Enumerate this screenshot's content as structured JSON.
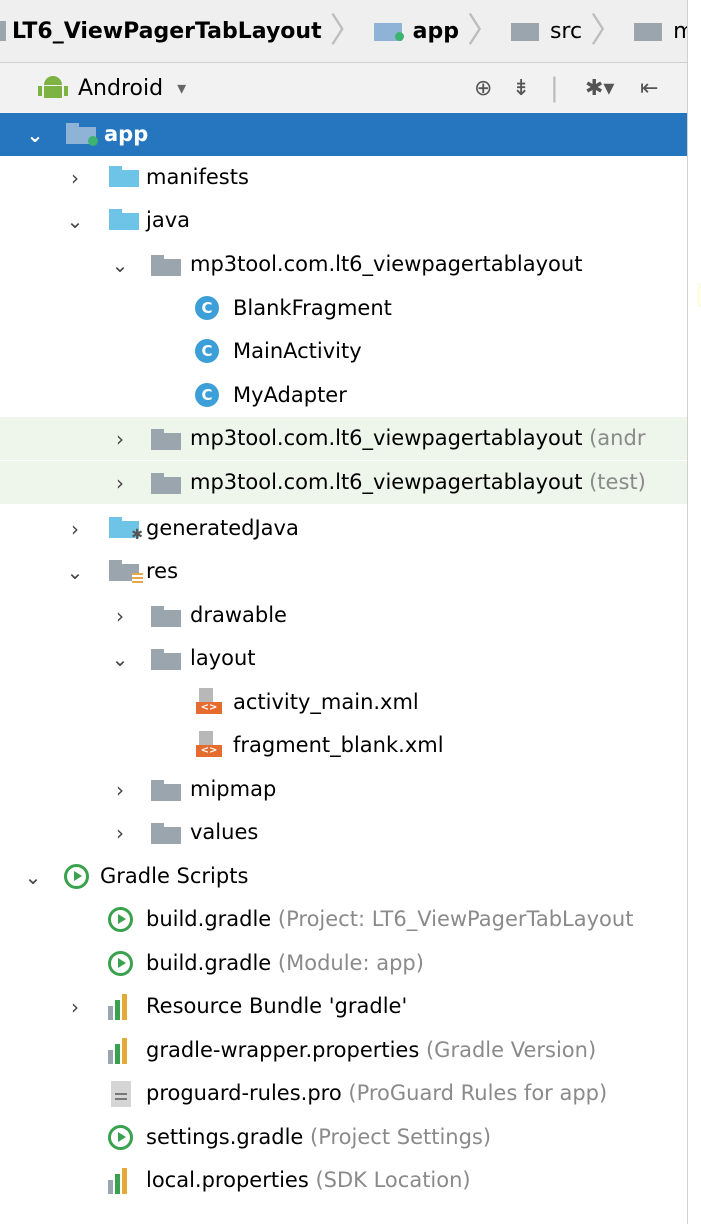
{
  "breadcrumb": {
    "items": [
      "LT6_ViewPagerTabLayout",
      "app",
      "src",
      "main"
    ]
  },
  "toolbar": {
    "view_label": "Android",
    "dropdown_icon": "chevron-down-icon",
    "tools": [
      "crosshair-icon",
      "collapse-icon",
      "gear-icon",
      "hide-icon"
    ]
  },
  "tree": {
    "app": "app",
    "manifests": "manifests",
    "java": "java",
    "pkg_main": "mp3tool.com.lt6_viewpagertablayout",
    "class_1": "BlankFragment",
    "class_2": "MainActivity",
    "class_3": "MyAdapter",
    "pkg_android": "mp3tool.com.lt6_viewpagertablayout",
    "pkg_android_hint": " (andr",
    "pkg_test": "mp3tool.com.lt6_viewpagertablayout",
    "pkg_test_hint": " (test)",
    "generated": "generatedJava",
    "res": "res",
    "drawable": "drawable",
    "layout": "layout",
    "xml_1": "activity_main.xml",
    "xml_2": "fragment_blank.xml",
    "mipmap": "mipmap",
    "values": "values",
    "gradle_scripts": "Gradle Scripts",
    "g1": "build.gradle",
    "g1_hint": " (Project: LT6_ViewPagerTabLayout",
    "g2": "build.gradle",
    "g2_hint": " (Module: app)",
    "g3": "Resource Bundle 'gradle'",
    "g4": "gradle-wrapper.properties",
    "g4_hint": " (Gradle Version)",
    "g5": "proguard-rules.pro",
    "g5_hint": " (ProGuard Rules for app)",
    "g6": "settings.gradle",
    "g6_hint": " (Project Settings)",
    "g7": "local.properties",
    "g7_hint": " (SDK Location)"
  },
  "colors": {
    "selection": "#2675bf",
    "folder": "#8fb3d6",
    "class_icon": "#3d9fd8",
    "gradle": "#3aa14e"
  }
}
